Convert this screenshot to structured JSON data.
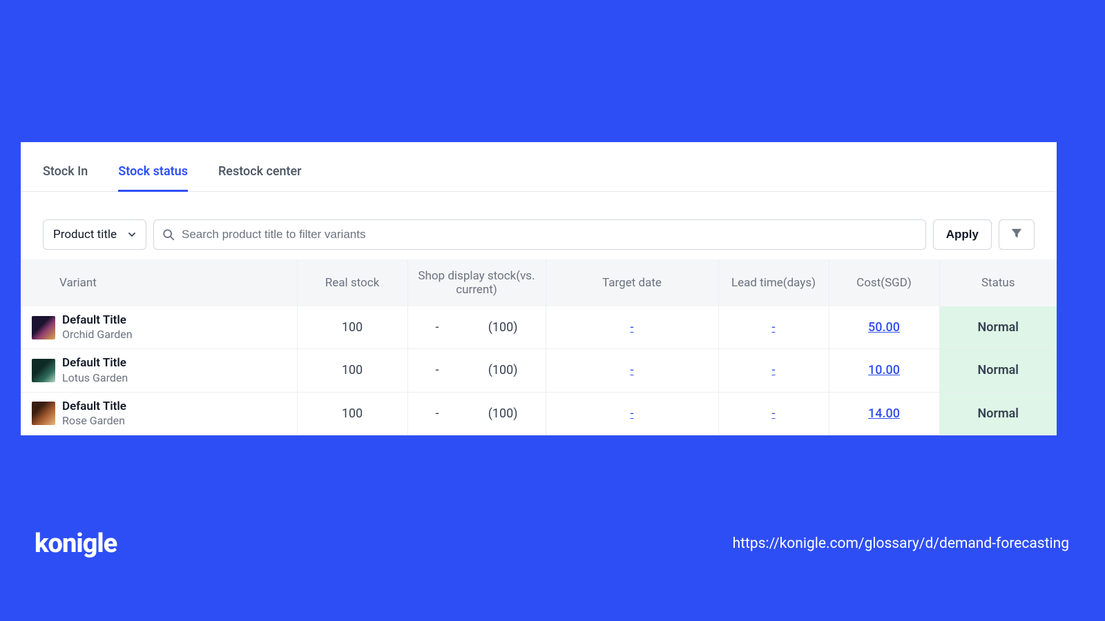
{
  "tabs": [
    {
      "label": "Stock In",
      "active": false
    },
    {
      "label": "Stock status",
      "active": true
    },
    {
      "label": "Restock center",
      "active": false
    }
  ],
  "toolbar": {
    "select_label": "Product title",
    "search_placeholder": "Search product title to filter variants",
    "apply_label": "Apply"
  },
  "columns": {
    "variant": "Variant",
    "real_stock": "Real stock",
    "display_stock": "Shop display stock(vs. current)",
    "target_date": "Target date",
    "lead_time": "Lead time(days)",
    "cost": "Cost(SGD)",
    "status": "Status"
  },
  "rows": [
    {
      "title": "Default Title",
      "subtitle": "Orchid Garden",
      "real_stock": "100",
      "display_stock_left": "-",
      "display_stock_right": "(100)",
      "target_date": "-",
      "lead_time": "-",
      "cost": "50.00",
      "status": "Normal"
    },
    {
      "title": "Default Title",
      "subtitle": "Lotus Garden",
      "real_stock": "100",
      "display_stock_left": "-",
      "display_stock_right": "(100)",
      "target_date": "-",
      "lead_time": "-",
      "cost": "10.00",
      "status": "Normal"
    },
    {
      "title": "Default Title",
      "subtitle": "Rose Garden",
      "real_stock": "100",
      "display_stock_left": "-",
      "display_stock_right": "(100)",
      "target_date": "-",
      "lead_time": "-",
      "cost": "14.00",
      "status": "Normal"
    }
  ],
  "branding": {
    "logo": "konigle",
    "url": "https://konigle.com/glossary/d/demand-forecasting"
  }
}
